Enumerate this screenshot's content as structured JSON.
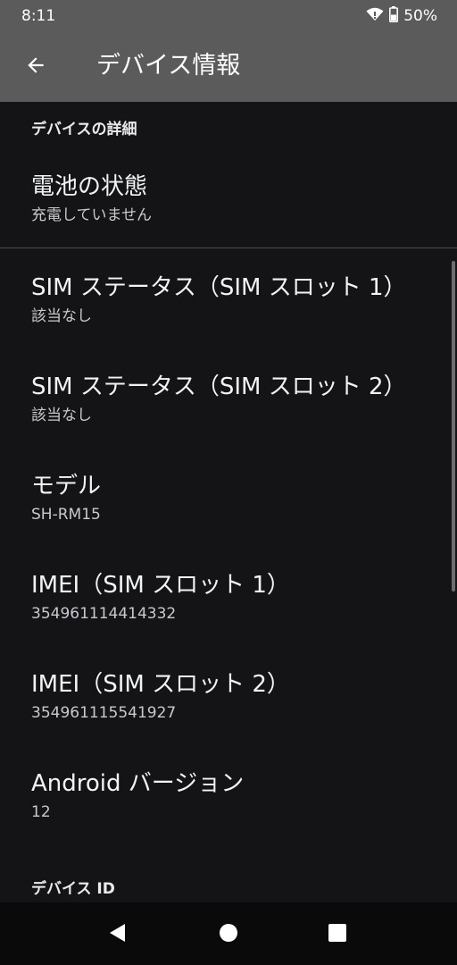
{
  "status_bar": {
    "time": "8:11",
    "battery_text": "50%",
    "icons": [
      "wifi-icon",
      "battery-icon"
    ]
  },
  "app_bar": {
    "title": "デバイス情報",
    "back_icon": "back-arrow-icon"
  },
  "sections": [
    {
      "header": "デバイスの詳細",
      "items": [
        {
          "title": "電池の状態",
          "summary": "充電していません"
        }
      ]
    },
    {
      "header": "",
      "items": [
        {
          "title": "SIM ステータス（SIM スロット 1）",
          "summary": "該当なし"
        },
        {
          "title": "SIM ステータス（SIM スロット 2）",
          "summary": "該当なし"
        },
        {
          "title": "モデル",
          "summary": "SH-RM15"
        },
        {
          "title": "IMEI（SIM スロット 1）",
          "summary": "354961114414332"
        },
        {
          "title": "IMEI（SIM スロット 2）",
          "summary": "354961115541927"
        },
        {
          "title": "Android バージョン",
          "summary": "12"
        }
      ]
    },
    {
      "header": "デバイス ID",
      "items": []
    }
  ],
  "nav_bar": {
    "icons": [
      "back-triangle-icon",
      "home-circle-icon",
      "recents-square-icon"
    ]
  },
  "colors": {
    "background": "#141416",
    "app_bar": "#5b5b5b",
    "nav_bar": "#0a0a0a"
  }
}
